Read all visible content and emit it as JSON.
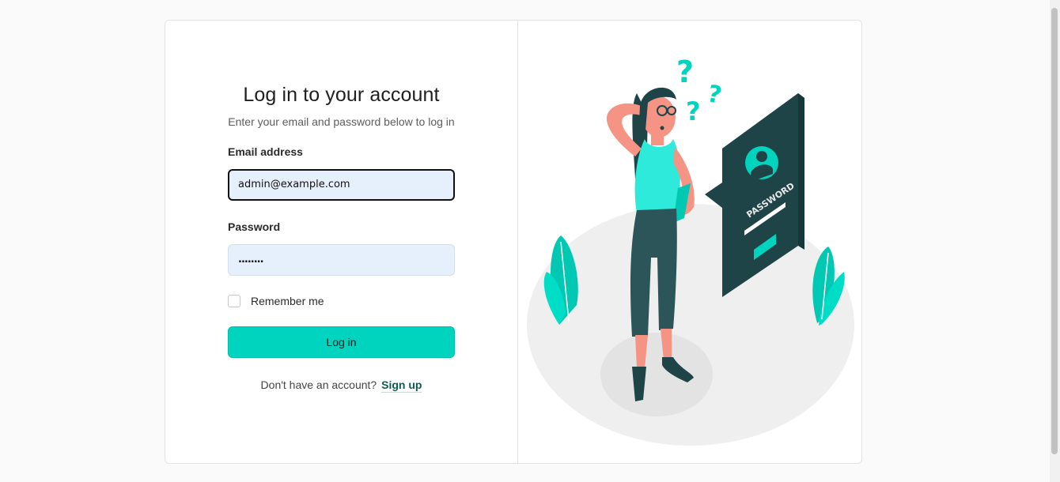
{
  "login": {
    "title": "Log in to your account",
    "subtitle": "Enter your email and password below to log in",
    "email_label": "Email address",
    "email_value": "admin@example.com",
    "password_label": "Password",
    "password_value": "........",
    "remember_label": "Remember me",
    "remember_checked": false,
    "submit_label": "Log in",
    "signup_prompt": "Don't have an account?",
    "signup_link": "Sign up"
  },
  "illustration": {
    "sign_text": "PASSWORD",
    "accent_color": "#00d4be",
    "dark_color": "#1f4448"
  },
  "colors": {
    "button": "#00d4be",
    "input_bg": "#e6f0fc"
  }
}
